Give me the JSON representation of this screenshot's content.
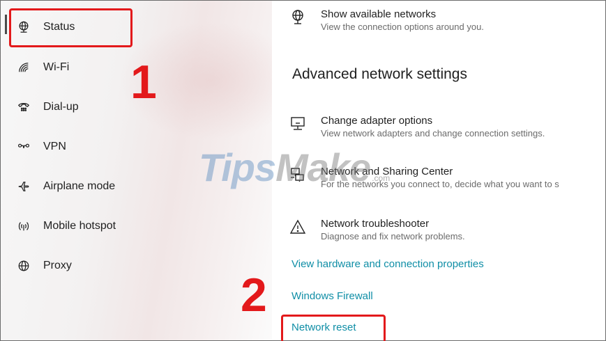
{
  "sidebar": {
    "items": [
      {
        "label": "Status",
        "icon": "status-globe-icon"
      },
      {
        "label": "Wi-Fi",
        "icon": "wifi-icon"
      },
      {
        "label": "Dial-up",
        "icon": "dial-up-icon"
      },
      {
        "label": "VPN",
        "icon": "vpn-icon"
      },
      {
        "label": "Airplane mode",
        "icon": "airplane-icon"
      },
      {
        "label": "Mobile hotspot",
        "icon": "hotspot-icon"
      },
      {
        "label": "Proxy",
        "icon": "globe-icon"
      }
    ]
  },
  "main": {
    "show_networks": {
      "title": "Show available networks",
      "desc": "View the connection options around you."
    },
    "section_heading": "Advanced network settings",
    "settings": [
      {
        "title": "Change adapter options",
        "desc": "View network adapters and change connection settings.",
        "icon": "adapter-monitor-icon"
      },
      {
        "title": "Network and Sharing Center",
        "desc": "For the networks you connect to, decide what you want to s",
        "icon": "sharing-center-icon"
      },
      {
        "title": "Network troubleshooter",
        "desc": "Diagnose and fix network problems.",
        "icon": "warning-triangle-icon"
      }
    ],
    "links": {
      "hardware": "View hardware and connection properties",
      "firewall": "Windows Firewall",
      "reset": "Network reset"
    }
  },
  "annotations": {
    "step1": "1",
    "step2": "2",
    "highlight_color": "#e3191b"
  },
  "watermark": {
    "part1": "Tips",
    "part2": "Make",
    "suffix": ".com"
  }
}
